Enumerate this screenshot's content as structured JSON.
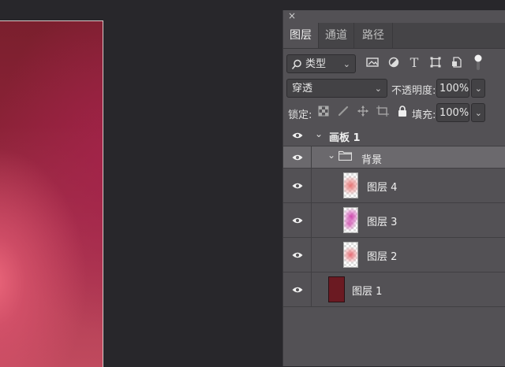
{
  "panel": {
    "close_label": "×",
    "tabs": [
      {
        "label": "图层",
        "active": true
      },
      {
        "label": "通道",
        "active": false
      },
      {
        "label": "路径",
        "active": false
      }
    ],
    "filter": {
      "search_icon": "search-icon",
      "kind_label": "类型",
      "filter_icons": [
        "image-filter-icon",
        "adjustment-filter-icon",
        "type-filter-icon",
        "shape-filter-icon",
        "smartobject-filter-icon"
      ]
    },
    "blend": {
      "mode_label": "穿透",
      "opacity_label": "不透明度:",
      "opacity_value": "100%"
    },
    "lock": {
      "lock_label": "锁定:",
      "fill_label": "填充:",
      "fill_value": "100%"
    },
    "layers": [
      {
        "name": "画板 1",
        "kind": "artboard"
      },
      {
        "name": "背景",
        "kind": "group"
      },
      {
        "name": "图层 4",
        "kind": "layer"
      },
      {
        "name": "图层 3",
        "kind": "layer"
      },
      {
        "name": "图层 2",
        "kind": "layer"
      },
      {
        "name": "图层 1",
        "kind": "layer"
      }
    ]
  },
  "colors": {
    "panel_bg": "#535155",
    "selected_row": "#6b696d",
    "canvas_bg": "#28272b",
    "artboard_fill": "#8b2237"
  }
}
